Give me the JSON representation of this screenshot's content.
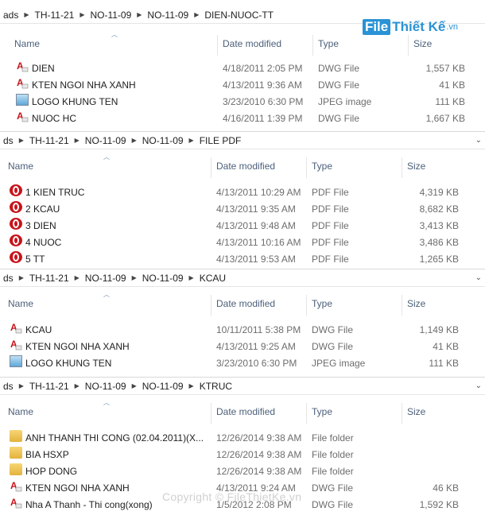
{
  "watermark": {
    "part1": "File",
    "part2": "Thiết Kế",
    "part3": ".vn"
  },
  "copyright": "Copyright © FileThietKe.vn",
  "columns": {
    "name": "Name",
    "date": "Date modified",
    "type": "Type",
    "size": "Size"
  },
  "panes": [
    {
      "breadcrumb": [
        "ads",
        "TH-11-21",
        "NO-11-09",
        "NO-11-09",
        "DIEN-NUOC-TT"
      ],
      "rows": [
        {
          "name": "DIEN",
          "date": "4/18/2011 2:05 PM",
          "type": "DWG File",
          "size": "1,557 KB",
          "icon": "dwg-icon"
        },
        {
          "name": "KTEN NGOI NHA XANH",
          "date": "4/13/2011 9:36 AM",
          "type": "DWG File",
          "size": "41 KB",
          "icon": "dwg-icon"
        },
        {
          "name": "LOGO KHUNG TEN",
          "date": "3/23/2010 6:30 PM",
          "type": "JPEG image",
          "size": "111 KB",
          "icon": "jpeg-icon"
        },
        {
          "name": "NUOC HC",
          "date": "4/16/2011 1:39 PM",
          "type": "DWG File",
          "size": "1,667 KB",
          "icon": "dwg-icon"
        }
      ]
    },
    {
      "breadcrumb": [
        "ds",
        "TH-11-21",
        "NO-11-09",
        "NO-11-09",
        "FILE PDF"
      ],
      "rows": [
        {
          "name": "1 KIEN TRUC",
          "date": "4/13/2011 10:29 AM",
          "type": "PDF File",
          "size": "4,319 KB",
          "icon": "pdf-icon"
        },
        {
          "name": "2 KCAU",
          "date": "4/13/2011 9:35 AM",
          "type": "PDF File",
          "size": "8,682 KB",
          "icon": "pdf-icon"
        },
        {
          "name": "3 DIEN",
          "date": "4/13/2011 9:48 AM",
          "type": "PDF File",
          "size": "3,413 KB",
          "icon": "pdf-icon"
        },
        {
          "name": "4 NUOC",
          "date": "4/13/2011 10:16 AM",
          "type": "PDF File",
          "size": "3,486 KB",
          "icon": "pdf-icon"
        },
        {
          "name": "5 TT",
          "date": "4/13/2011 9:53 AM",
          "type": "PDF File",
          "size": "1,265 KB",
          "icon": "pdf-icon"
        }
      ]
    },
    {
      "breadcrumb": [
        "ds",
        "TH-11-21",
        "NO-11-09",
        "NO-11-09",
        "KCAU"
      ],
      "rows": [
        {
          "name": "KCAU",
          "date": "10/11/2011 5:38 PM",
          "type": "DWG File",
          "size": "1,149 KB",
          "icon": "dwg-icon"
        },
        {
          "name": "KTEN NGOI NHA XANH",
          "date": "4/13/2011 9:25 AM",
          "type": "DWG File",
          "size": "41 KB",
          "icon": "dwg-icon"
        },
        {
          "name": "LOGO KHUNG TEN",
          "date": "3/23/2010 6:30 PM",
          "type": "JPEG image",
          "size": "111 KB",
          "icon": "jpeg-icon"
        }
      ]
    },
    {
      "breadcrumb": [
        "ds",
        "TH-11-21",
        "NO-11-09",
        "NO-11-09",
        "KTRUC"
      ],
      "rows": [
        {
          "name": "ANH  THANH THI CONG (02.04.2011)(X...",
          "date": "12/26/2014 9:38 AM",
          "type": "File folder",
          "size": "",
          "icon": "folder-icon"
        },
        {
          "name": "BIA HSXP",
          "date": "12/26/2014 9:38 AM",
          "type": "File folder",
          "size": "",
          "icon": "folder-icon"
        },
        {
          "name": "HOP DONG",
          "date": "12/26/2014 9:38 AM",
          "type": "File folder",
          "size": "",
          "icon": "folder-icon"
        },
        {
          "name": "KTEN NGOI NHA XANH",
          "date": "4/13/2011 9:24 AM",
          "type": "DWG File",
          "size": "46 KB",
          "icon": "dwg-icon"
        },
        {
          "name": "Nha A Thanh - Thi cong(xong)",
          "date": "1/5/2012 2:08 PM",
          "type": "DWG File",
          "size": "1,592 KB",
          "icon": "dwg-icon"
        }
      ]
    }
  ]
}
